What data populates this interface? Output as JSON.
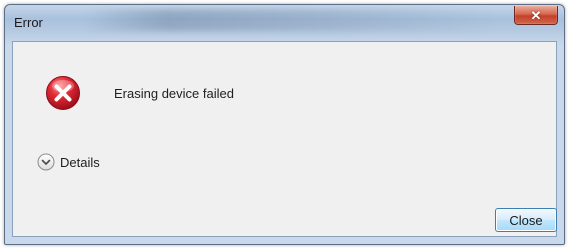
{
  "window": {
    "title": "Error",
    "close_icon": "close-icon",
    "close_glyph": "✕"
  },
  "dialog": {
    "icon": "error-icon",
    "message": "Erasing device failed",
    "details_label": "Details",
    "details_icon": "chevron-down-icon",
    "close_button_label": "Close"
  },
  "colors": {
    "error_red": "#d3162a",
    "button_border": "#3c7fb1",
    "client_background": "#f0f0f0"
  }
}
